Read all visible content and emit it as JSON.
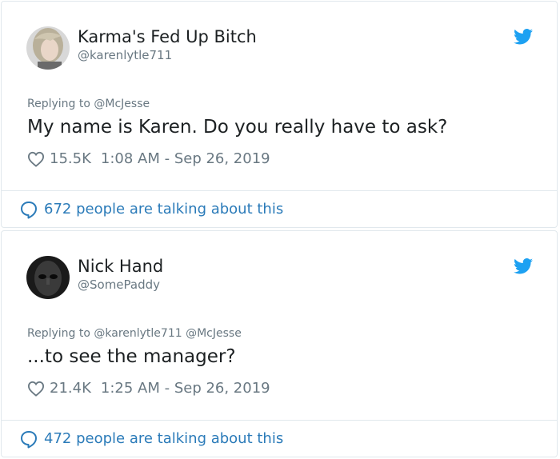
{
  "colors": {
    "text": "#1c2022",
    "muted": "#697882",
    "link": "#2b7bb9",
    "twitter_blue": "#1da1f2",
    "border": "#e1e8ed"
  },
  "tweets": [
    {
      "avatar_icon": "user-avatar-photo",
      "display_name": "Karma's Fed Up Bitch",
      "handle": "@karenlytle711",
      "replying_to": "Replying to @McJesse",
      "text": "My name is Karen. Do you really have to ask?",
      "likes": "15.5K",
      "timestamp": "1:08 AM - Sep 26, 2019",
      "talking": "672 people are talking about this"
    },
    {
      "avatar_icon": "user-avatar-photo",
      "display_name": "Nick Hand",
      "handle": "@SomePaddy",
      "replying_to": "Replying to @karenlytle711 @McJesse",
      "text": "...to see the manager?",
      "likes": "21.4K",
      "timestamp": "1:25 AM - Sep 26, 2019",
      "talking": "472 people are talking about this"
    }
  ]
}
